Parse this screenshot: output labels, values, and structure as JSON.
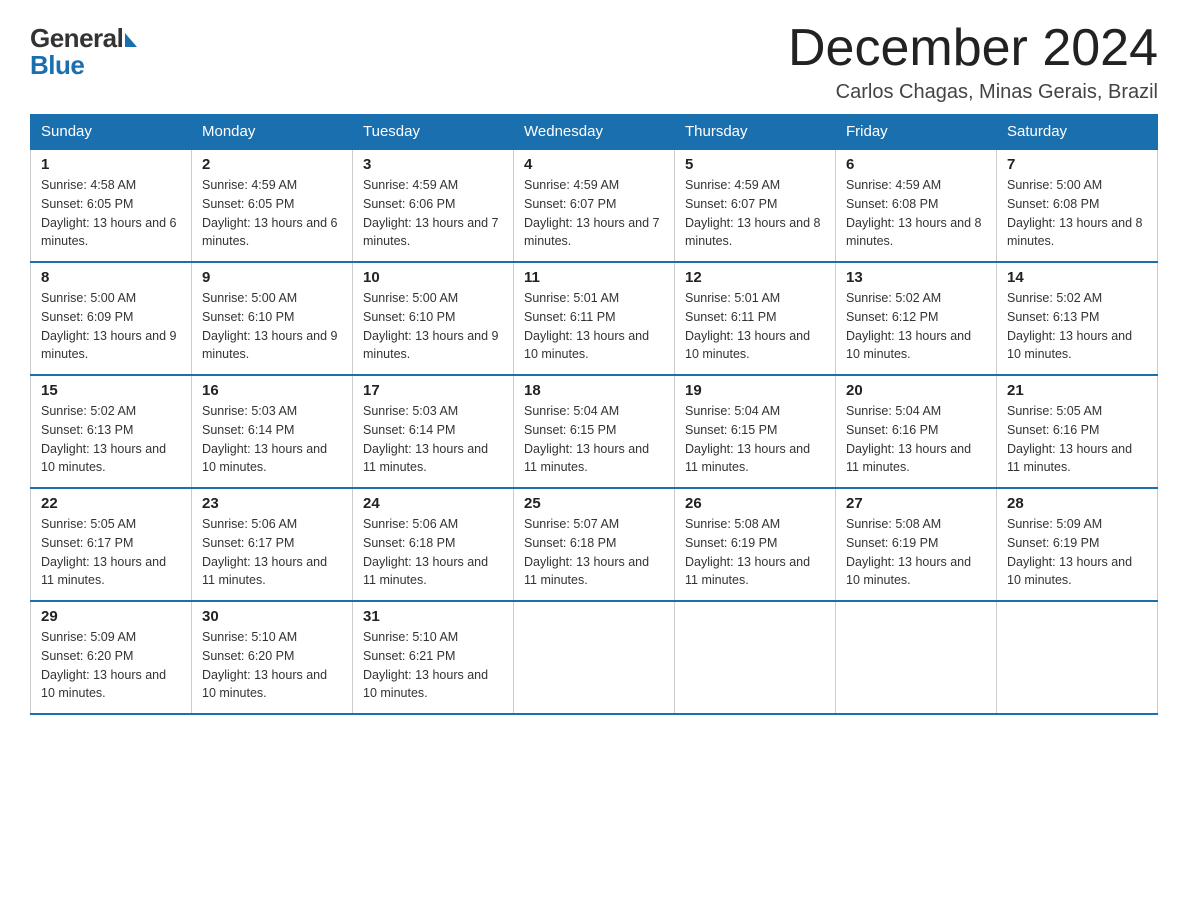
{
  "header": {
    "logo_general": "General",
    "logo_blue": "Blue",
    "month_title": "December 2024",
    "location": "Carlos Chagas, Minas Gerais, Brazil"
  },
  "days_of_week": [
    "Sunday",
    "Monday",
    "Tuesday",
    "Wednesday",
    "Thursday",
    "Friday",
    "Saturday"
  ],
  "weeks": [
    [
      {
        "day": "1",
        "sunrise": "4:58 AM",
        "sunset": "6:05 PM",
        "daylight": "13 hours and 6 minutes."
      },
      {
        "day": "2",
        "sunrise": "4:59 AM",
        "sunset": "6:05 PM",
        "daylight": "13 hours and 6 minutes."
      },
      {
        "day": "3",
        "sunrise": "4:59 AM",
        "sunset": "6:06 PM",
        "daylight": "13 hours and 7 minutes."
      },
      {
        "day": "4",
        "sunrise": "4:59 AM",
        "sunset": "6:07 PM",
        "daylight": "13 hours and 7 minutes."
      },
      {
        "day": "5",
        "sunrise": "4:59 AM",
        "sunset": "6:07 PM",
        "daylight": "13 hours and 8 minutes."
      },
      {
        "day": "6",
        "sunrise": "4:59 AM",
        "sunset": "6:08 PM",
        "daylight": "13 hours and 8 minutes."
      },
      {
        "day": "7",
        "sunrise": "5:00 AM",
        "sunset": "6:08 PM",
        "daylight": "13 hours and 8 minutes."
      }
    ],
    [
      {
        "day": "8",
        "sunrise": "5:00 AM",
        "sunset": "6:09 PM",
        "daylight": "13 hours and 9 minutes."
      },
      {
        "day": "9",
        "sunrise": "5:00 AM",
        "sunset": "6:10 PM",
        "daylight": "13 hours and 9 minutes."
      },
      {
        "day": "10",
        "sunrise": "5:00 AM",
        "sunset": "6:10 PM",
        "daylight": "13 hours and 9 minutes."
      },
      {
        "day": "11",
        "sunrise": "5:01 AM",
        "sunset": "6:11 PM",
        "daylight": "13 hours and 10 minutes."
      },
      {
        "day": "12",
        "sunrise": "5:01 AM",
        "sunset": "6:11 PM",
        "daylight": "13 hours and 10 minutes."
      },
      {
        "day": "13",
        "sunrise": "5:02 AM",
        "sunset": "6:12 PM",
        "daylight": "13 hours and 10 minutes."
      },
      {
        "day": "14",
        "sunrise": "5:02 AM",
        "sunset": "6:13 PM",
        "daylight": "13 hours and 10 minutes."
      }
    ],
    [
      {
        "day": "15",
        "sunrise": "5:02 AM",
        "sunset": "6:13 PM",
        "daylight": "13 hours and 10 minutes."
      },
      {
        "day": "16",
        "sunrise": "5:03 AM",
        "sunset": "6:14 PM",
        "daylight": "13 hours and 10 minutes."
      },
      {
        "day": "17",
        "sunrise": "5:03 AM",
        "sunset": "6:14 PM",
        "daylight": "13 hours and 11 minutes."
      },
      {
        "day": "18",
        "sunrise": "5:04 AM",
        "sunset": "6:15 PM",
        "daylight": "13 hours and 11 minutes."
      },
      {
        "day": "19",
        "sunrise": "5:04 AM",
        "sunset": "6:15 PM",
        "daylight": "13 hours and 11 minutes."
      },
      {
        "day": "20",
        "sunrise": "5:04 AM",
        "sunset": "6:16 PM",
        "daylight": "13 hours and 11 minutes."
      },
      {
        "day": "21",
        "sunrise": "5:05 AM",
        "sunset": "6:16 PM",
        "daylight": "13 hours and 11 minutes."
      }
    ],
    [
      {
        "day": "22",
        "sunrise": "5:05 AM",
        "sunset": "6:17 PM",
        "daylight": "13 hours and 11 minutes."
      },
      {
        "day": "23",
        "sunrise": "5:06 AM",
        "sunset": "6:17 PM",
        "daylight": "13 hours and 11 minutes."
      },
      {
        "day": "24",
        "sunrise": "5:06 AM",
        "sunset": "6:18 PM",
        "daylight": "13 hours and 11 minutes."
      },
      {
        "day": "25",
        "sunrise": "5:07 AM",
        "sunset": "6:18 PM",
        "daylight": "13 hours and 11 minutes."
      },
      {
        "day": "26",
        "sunrise": "5:08 AM",
        "sunset": "6:19 PM",
        "daylight": "13 hours and 11 minutes."
      },
      {
        "day": "27",
        "sunrise": "5:08 AM",
        "sunset": "6:19 PM",
        "daylight": "13 hours and 10 minutes."
      },
      {
        "day": "28",
        "sunrise": "5:09 AM",
        "sunset": "6:19 PM",
        "daylight": "13 hours and 10 minutes."
      }
    ],
    [
      {
        "day": "29",
        "sunrise": "5:09 AM",
        "sunset": "6:20 PM",
        "daylight": "13 hours and 10 minutes."
      },
      {
        "day": "30",
        "sunrise": "5:10 AM",
        "sunset": "6:20 PM",
        "daylight": "13 hours and 10 minutes."
      },
      {
        "day": "31",
        "sunrise": "5:10 AM",
        "sunset": "6:21 PM",
        "daylight": "13 hours and 10 minutes."
      },
      null,
      null,
      null,
      null
    ]
  ],
  "labels": {
    "sunrise_prefix": "Sunrise: ",
    "sunset_prefix": "Sunset: ",
    "daylight_prefix": "Daylight: "
  }
}
